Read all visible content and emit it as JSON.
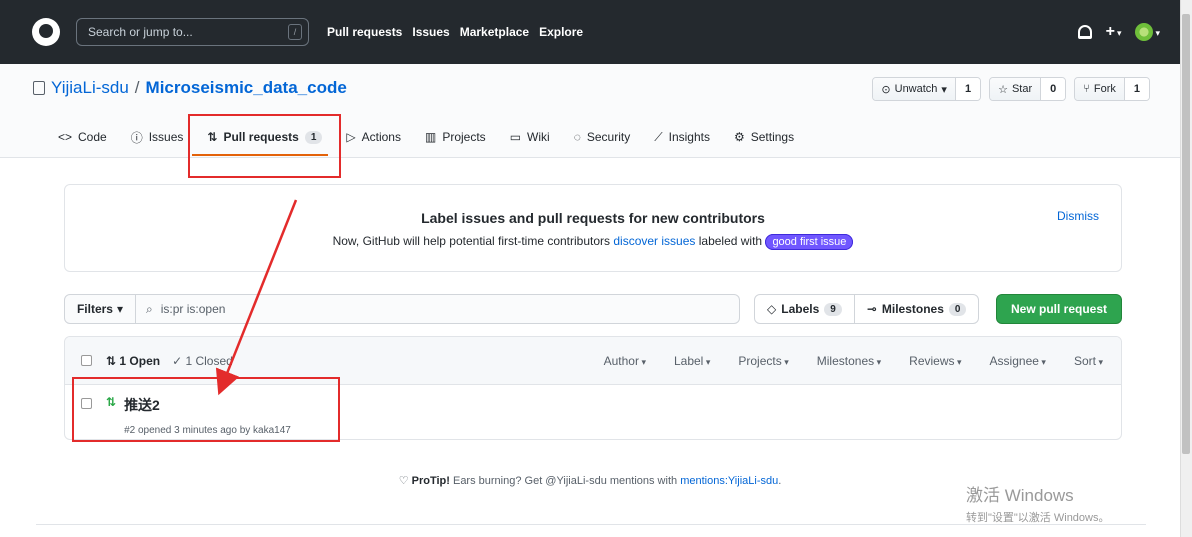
{
  "header": {
    "search_placeholder": "Search or jump to...",
    "search_key": "/",
    "nav": [
      "Pull requests",
      "Issues",
      "Marketplace",
      "Explore"
    ]
  },
  "repo": {
    "owner": "YijiaLi-sdu",
    "separator": "/",
    "name": "Microseismic_data_code",
    "watch_label": "Unwatch",
    "watch_count": "1",
    "star_label": "Star",
    "star_count": "0",
    "fork_label": "Fork",
    "fork_count": "1"
  },
  "tabs": [
    {
      "label": "Code",
      "icon": "code-icon"
    },
    {
      "label": "Issues",
      "icon": "issue-icon"
    },
    {
      "label": "Pull requests",
      "icon": "pull-request-icon",
      "count": "1",
      "active": true
    },
    {
      "label": "Actions",
      "icon": "play-icon"
    },
    {
      "label": "Projects",
      "icon": "project-icon"
    },
    {
      "label": "Wiki",
      "icon": "book-icon"
    },
    {
      "label": "Security",
      "icon": "shield-icon"
    },
    {
      "label": "Insights",
      "icon": "graph-icon"
    },
    {
      "label": "Settings",
      "icon": "gear-icon"
    }
  ],
  "banner": {
    "title": "Label issues and pull requests for new contributors",
    "text_before": "Now, GitHub will help potential first-time contributors ",
    "link": "discover issues",
    "text_after": " labeled with ",
    "label": "good first issue",
    "dismiss": "Dismiss"
  },
  "filters": {
    "button": "Filters",
    "query": "is:pr is:open",
    "labels": "Labels",
    "labels_count": "9",
    "milestones": "Milestones",
    "milestones_count": "0",
    "new_pr": "New pull request"
  },
  "list": {
    "open": "1 Open",
    "closed": "1 Closed",
    "sorts": [
      "Author",
      "Label",
      "Projects",
      "Milestones",
      "Reviews",
      "Assignee",
      "Sort"
    ],
    "items": [
      {
        "title": "推送2",
        "meta": "#2 opened 3 minutes ago by kaka147"
      }
    ]
  },
  "protip": {
    "lead": "ProTip!",
    "text": " Ears burning? Get @YijiaLi-sdu mentions with ",
    "link": "mentions:YijiaLi-sdu",
    "end": "."
  },
  "watermark": {
    "line1": "激活 Windows",
    "line2": "转到\"设置\"以激活 Windows。"
  },
  "colors": {
    "header_bg": "#24292e",
    "link": "#0366d6",
    "primary_button": "#2ea44f",
    "active_tab_underline": "#e36209",
    "good_first_issue": "#7057ff",
    "annotation_red": "#e32b2b"
  }
}
